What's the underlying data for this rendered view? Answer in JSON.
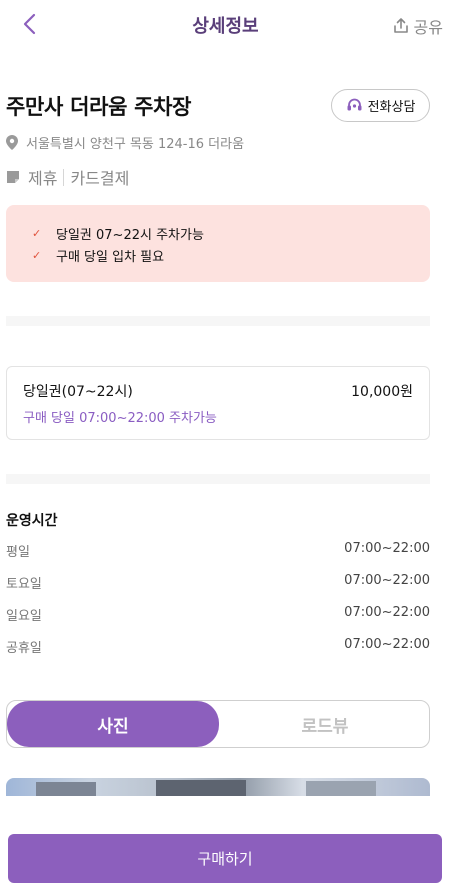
{
  "header": {
    "title": "상세정보",
    "share_label": "공유"
  },
  "lot": {
    "name": "주만사 더라움 주차장",
    "call_label": "전화상담",
    "address": "서울특별시 양천구 목동 124-16 더라움",
    "tags": [
      "제휴",
      "카드결제"
    ]
  },
  "notice": {
    "items": [
      "당일권 07~22시 주차가능",
      "구매 당일 입차 필요"
    ]
  },
  "ticket": {
    "name": "당일권(07~22시)",
    "price": "10,000원",
    "desc": "구매 당일 07:00~22:00 주차가능"
  },
  "hours": {
    "title": "운영시간",
    "rows": [
      {
        "day": "평일",
        "time": "07:00~22:00"
      },
      {
        "day": "토요일",
        "time": "07:00~22:00"
      },
      {
        "day": "일요일",
        "time": "07:00~22:00"
      },
      {
        "day": "공휴일",
        "time": "07:00~22:00"
      }
    ]
  },
  "view_toggle": {
    "photo_label": "사진",
    "roadview_label": "로드뷰",
    "selected": "사진"
  },
  "purchase": {
    "label": "구매하기"
  },
  "colors": {
    "accent": "#8c5fbd",
    "notice_bg": "#fde2df",
    "check": "#e0523c"
  }
}
